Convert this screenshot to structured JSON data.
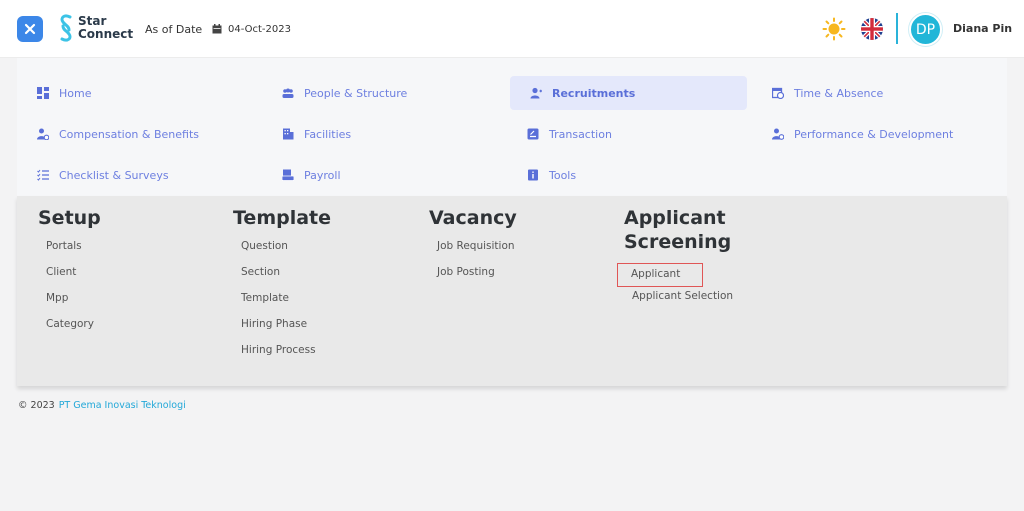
{
  "header": {
    "logo_line1": "Star",
    "logo_line2": "Connect",
    "as_of_label": "As of Date",
    "date": "04-Oct-2023",
    "avatar_initials": "DP",
    "user_name": "Diana Pin"
  },
  "menu": {
    "items": [
      {
        "label": "Home",
        "icon": "dashboard-icon"
      },
      {
        "label": "People & Structure",
        "icon": "people-icon"
      },
      {
        "label": "Recruitments",
        "icon": "recruit-icon",
        "active": true
      },
      {
        "label": "Time & Absence",
        "icon": "calendar-clock-icon"
      },
      {
        "label": "Compensation & Benefits",
        "icon": "compensation-icon"
      },
      {
        "label": "Facilities",
        "icon": "building-icon"
      },
      {
        "label": "Transaction",
        "icon": "transaction-icon"
      },
      {
        "label": "Performance & Development",
        "icon": "performance-icon"
      },
      {
        "label": "Checklist & Surveys",
        "icon": "checklist-icon"
      },
      {
        "label": "Payroll",
        "icon": "payroll-icon"
      },
      {
        "label": "Tools",
        "icon": "tools-icon"
      }
    ]
  },
  "submenu": {
    "setup": {
      "title": "Setup",
      "links": [
        "Portals",
        "Client",
        "Mpp",
        "Category"
      ]
    },
    "template": {
      "title": "Template",
      "links": [
        "Question",
        "Section",
        "Template",
        "Hiring Phase",
        "Hiring Process"
      ]
    },
    "vacancy": {
      "title": "Vacancy",
      "links": [
        "Job Requisition",
        "Job Posting"
      ]
    },
    "screening": {
      "title_line1": "Applicant",
      "title_line2": "Screening",
      "links": [
        "Applicant",
        "Applicant Selection"
      ]
    }
  },
  "footer": {
    "copyright": "© 2023",
    "company": "PT Gema Inovasi Teknologi"
  },
  "colors": {
    "accent": "#3c87e8",
    "menu_text": "#6d7fe0",
    "active_bg": "#e4e8fb",
    "highlight_border": "#e05656",
    "avatar": "#22b6d8"
  }
}
